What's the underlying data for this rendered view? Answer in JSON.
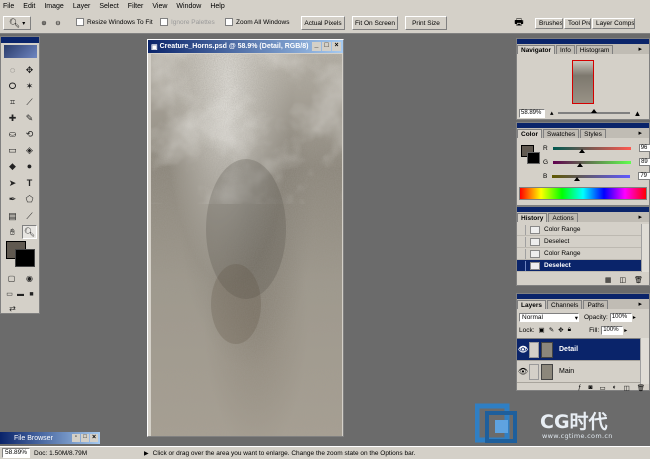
{
  "menu": [
    "File",
    "Edit",
    "Image",
    "Layer",
    "Select",
    "Filter",
    "View",
    "Window",
    "Help"
  ],
  "options": {
    "resize_windows": "Resize Windows To Fit",
    "ignore_palettes": "Ignore Palettes",
    "zoom_all": "Zoom All Windows",
    "actual_pixels": "Actual Pixels",
    "fit_on_screen": "Fit On Screen",
    "print_size": "Print Size",
    "tabs": [
      "Brushes",
      "Tool Presets",
      "Layer Comps"
    ]
  },
  "document": {
    "title": "Creature_Horns.psd @ 58.9% (Detail, RGB/8)"
  },
  "file_browser": {
    "label": "File Browser"
  },
  "status": {
    "zoom": "58.89%",
    "doc": "Doc: 1.50M/8.79M",
    "message": "Click or drag over the area you want to enlarge. Change the zoom state on the Options bar."
  },
  "navigator": {
    "tabs": [
      "Navigator",
      "Info",
      "Histogram"
    ],
    "zoom": "58.89%"
  },
  "color": {
    "tabs": [
      "Color",
      "Swatches",
      "Styles"
    ],
    "r_label": "R",
    "g_label": "G",
    "b_label": "B",
    "r": "96",
    "g": "89",
    "b": "79",
    "r_level": 0.376,
    "g_level": 0.349,
    "b_level": 0.31,
    "foreground": "#605950",
    "background": "#000000"
  },
  "history": {
    "tabs": [
      "History",
      "Actions"
    ],
    "items": [
      "Color Range",
      "Deselect",
      "Color Range",
      "Deselect"
    ],
    "selected_index": 3
  },
  "layers": {
    "tabs": [
      "Layers",
      "Channels",
      "Paths"
    ],
    "blend_mode": "Normal",
    "opacity_label": "Opacity:",
    "opacity": "100%",
    "lock_label": "Lock:",
    "fill_label": "Fill:",
    "fill": "100%",
    "items": [
      "Detail",
      "Main"
    ],
    "selected_index": 0
  },
  "watermark": {
    "brand": "CG时代",
    "url": "www.cgtime.com.cn"
  }
}
